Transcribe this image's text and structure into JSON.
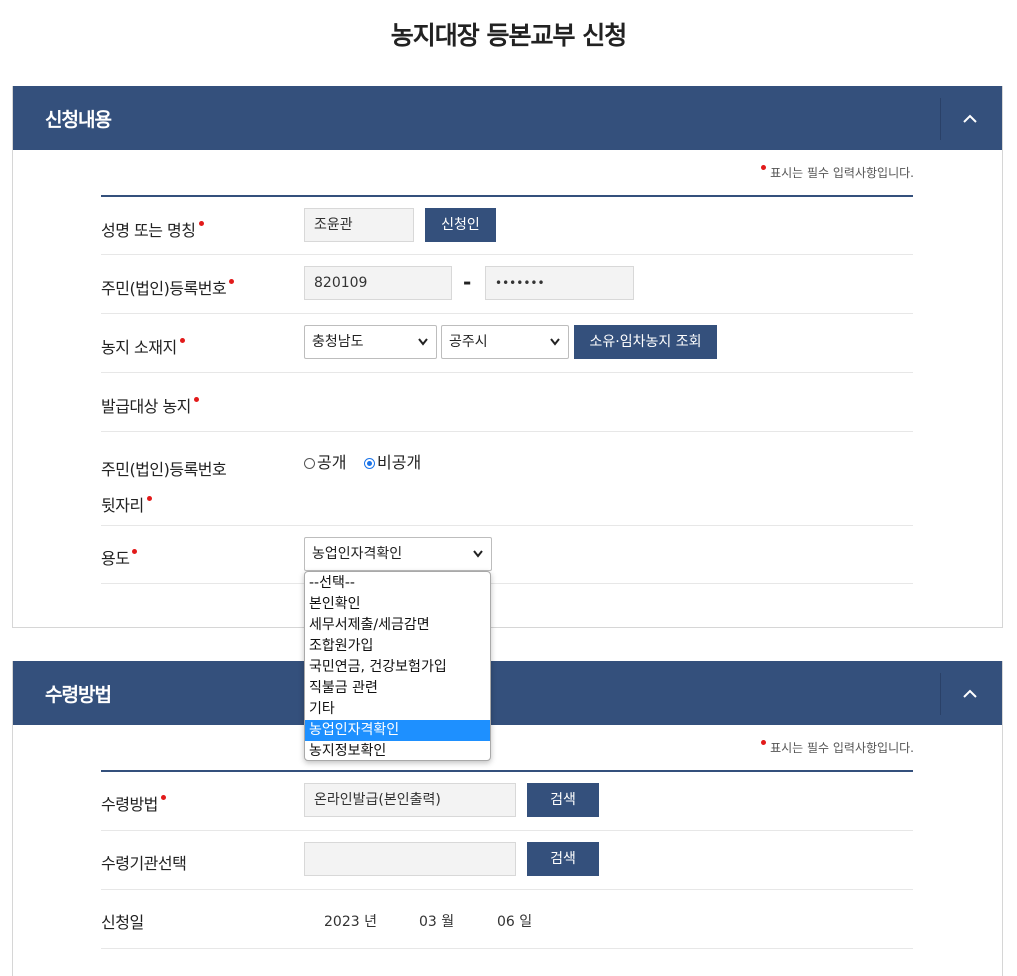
{
  "page": {
    "title": "농지대장 등본교부 신청"
  },
  "colors": {
    "header_bg": "#34507c",
    "required_dot": "#e21a1a",
    "selected_option": "#1e90ff"
  },
  "required_note": "표시는 필수 입력사항입니다.",
  "application": {
    "title": "신청내용",
    "name": {
      "label": "성명 또는 명칭",
      "value": "조윤관",
      "button": "신청인"
    },
    "resident_no": {
      "label": "주민(법인)등록번호",
      "front": "820109",
      "separator": "-",
      "back": "•••••••"
    },
    "location": {
      "label": "농지 소재지",
      "province": "충청남도",
      "city": "공주시",
      "button": "소유·임차농지 조회"
    },
    "target": {
      "label": "발급대상 농지"
    },
    "disclosure": {
      "label_line1": "주민(법인)등록번호",
      "label_line2": "뒷자리",
      "option_public": "공개",
      "option_private": "비공개",
      "selected": "비공개"
    },
    "purpose": {
      "label": "용도",
      "value": "농업인자격확인",
      "options": [
        "--선택--",
        "본인확인",
        "세무서제출/세금감면",
        "조합원가입",
        "국민연금, 건강보험가입",
        "직불금 관련",
        "기타",
        "농업인자격확인",
        "농지정보확인"
      ]
    }
  },
  "receipt": {
    "title": "수령방법",
    "method": {
      "label": "수령방법",
      "value": "온라인발급(본인출력)",
      "button": "검색"
    },
    "agency": {
      "label": "수령기관선택",
      "value": "",
      "button": "검색"
    },
    "date": {
      "label": "신청일",
      "year": "2023",
      "year_unit": "년",
      "month": "03",
      "month_unit": "월",
      "day": "06",
      "day_unit": "일"
    }
  },
  "icons": {
    "collapse": "chevron-up-icon",
    "select_arrow": "chevron-down-icon"
  }
}
